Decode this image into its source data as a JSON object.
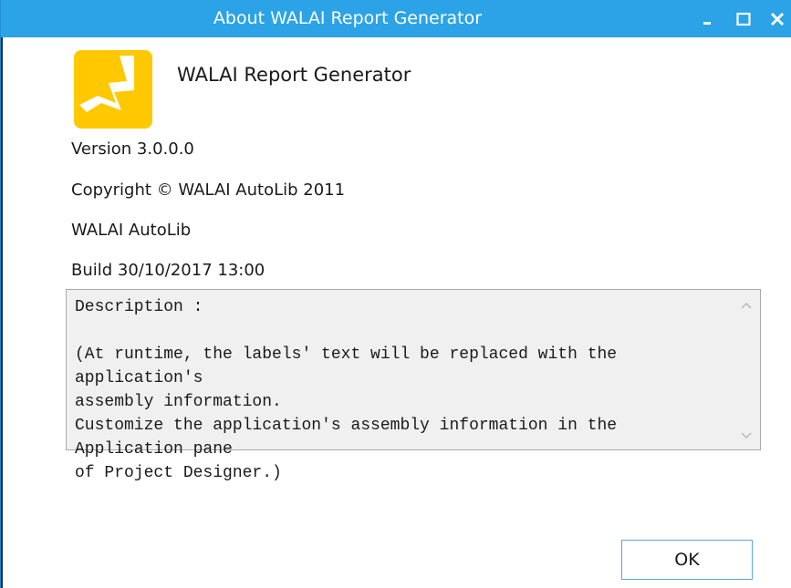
{
  "window": {
    "title": "About WALAI Report Generator",
    "controls": {
      "minimize_icon": "minimize-icon",
      "maximize_icon": "maximize-icon",
      "close_icon": "close-icon"
    },
    "colors": {
      "titlebar": "#2ba3e6",
      "logo": "#ffc800",
      "ok_border": "#5ea4e0"
    }
  },
  "about": {
    "product_name": "WALAI Report Generator",
    "version": "Version 3.0.0.0",
    "copyright": "Copyright © WALAI AutoLib 2011",
    "company": "WALAI AutoLib",
    "build": "Build 30/10/2017 13:00",
    "description": "Description :\n\n(At runtime, the labels' text will be replaced with the application's\nassembly information.\nCustomize the application's assembly information in the Application pane\nof Project Designer.)"
  },
  "buttons": {
    "ok_label": "OK"
  }
}
